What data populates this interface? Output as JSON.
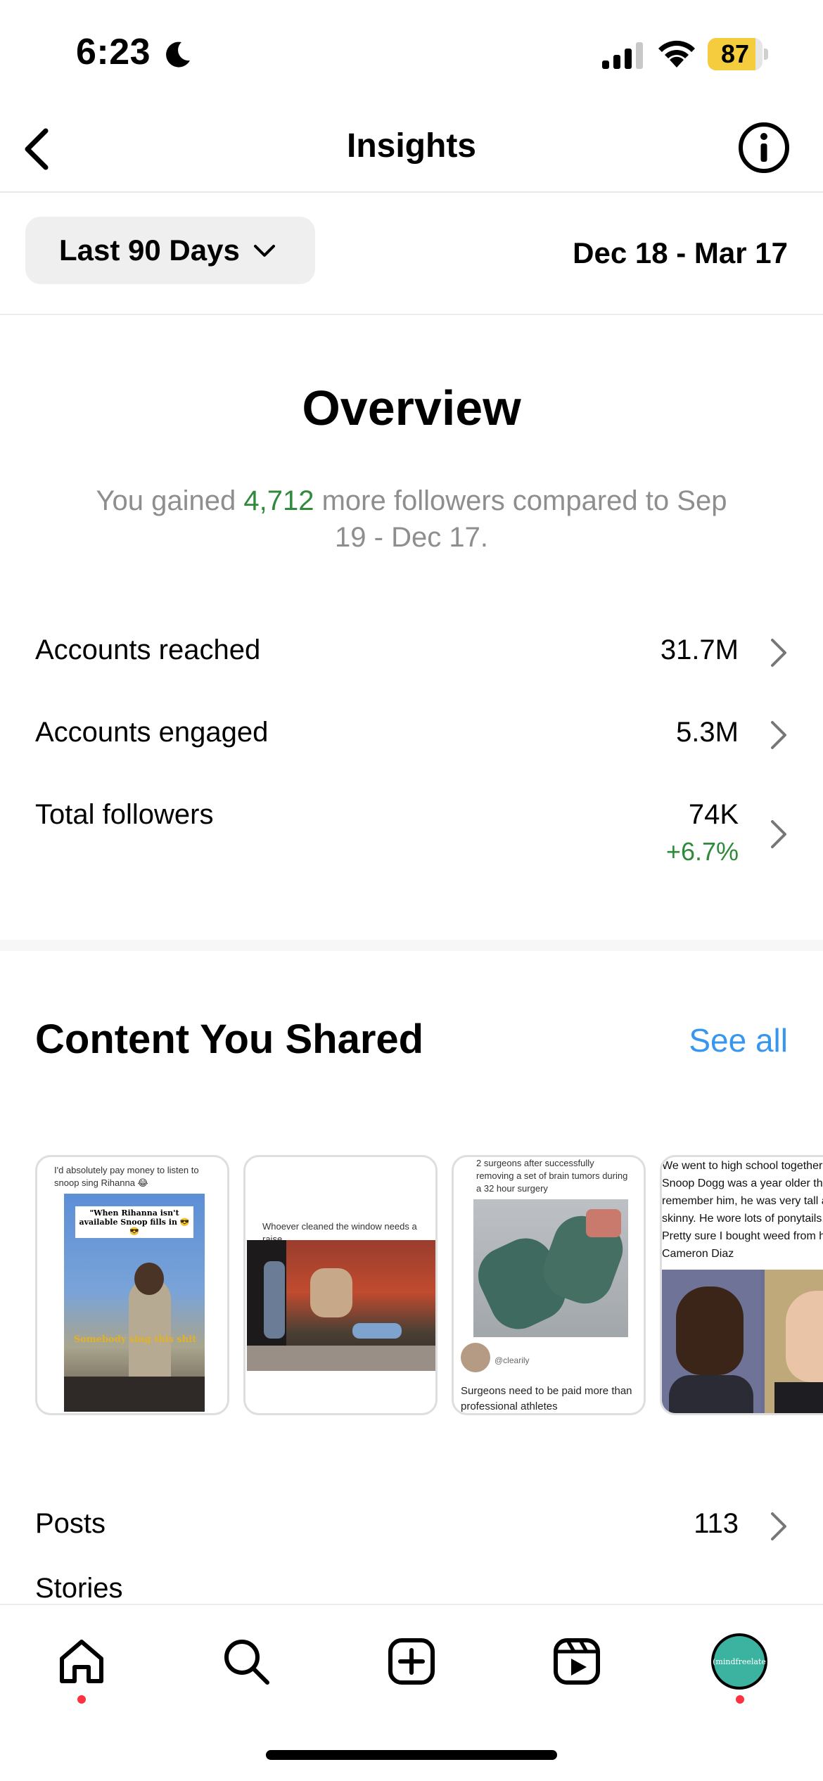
{
  "status_bar": {
    "time": "6:23",
    "battery_level": "87",
    "battery_fraction": 0.87
  },
  "header": {
    "title": "Insights",
    "back_icon": "chevron-left-icon",
    "info_icon": "info-circle-icon"
  },
  "filter": {
    "range_label": "Last 90 Days",
    "date_range": "Dec 18 - Mar 17"
  },
  "overview": {
    "title": "Overview",
    "summary_prefix": "You gained ",
    "summary_gain": "4,712",
    "summary_suffix": " more followers compared to Sep 19 - Dec 17.",
    "metrics": [
      {
        "label": "Accounts reached",
        "value": "31.7M"
      },
      {
        "label": "Accounts engaged",
        "value": "5.3M"
      },
      {
        "label": "Total followers",
        "value": "74K",
        "change": "+6.7%"
      }
    ]
  },
  "content_shared": {
    "title": "Content You Shared",
    "see_all": "See all",
    "thumbnails": [
      {
        "caption": "I'd absolutely pay money to listen to snoop sing Rihanna 😂",
        "inner_text": "\"When Rihanna isn't available Snoop fills in 😎😎",
        "overlay_text": "Somebody sing this shit"
      },
      {
        "caption": "Whoever cleaned the window needs a raise"
      },
      {
        "caption": "2 surgeons after successfully removing a set of brain tumors during a 32 hour surgery",
        "handle": "@clearily",
        "footer": "Surgeons need to be paid more than professional athletes"
      },
      {
        "caption": "We went to high school together Snoop Dogg was a year older than... remember him, he was very tall and skinny. He wore lots of ponytails. Pretty sure I bought weed from him. Cameron Diaz"
      }
    ]
  },
  "rows": [
    {
      "label": "Posts",
      "value": "113"
    }
  ],
  "partial_row": {
    "label": "Stories"
  },
  "tab_bar": {
    "items": [
      "home-icon",
      "search-icon",
      "create-icon",
      "reels-icon",
      "profile-avatar"
    ],
    "avatar_text": "(mindfreelate"
  }
}
